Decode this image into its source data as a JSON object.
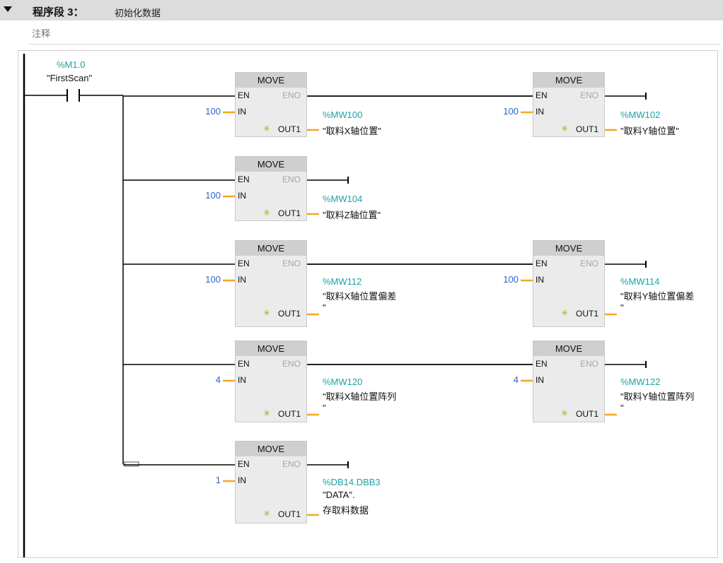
{
  "network": {
    "label": "程序段 3：",
    "title": "初始化数据",
    "comment": "注释"
  },
  "contact": {
    "address": "%M1.0",
    "tag": "\"FirstScan\""
  },
  "pins": {
    "block_title": "MOVE",
    "en": "EN",
    "eno": "ENO",
    "in": "IN",
    "out": "OUT1"
  },
  "colors": {
    "wire": "#000000",
    "output_wire": "#f5a623",
    "address": "#1ca3a6",
    "constant": "#2d64c7",
    "block_fill": "#ebebeb",
    "block_header": "#cfcfcf"
  },
  "blocks": [
    {
      "in_value": "100",
      "out_address": "%MW100",
      "out_lines": [
        "\"取料X轴位置\""
      ]
    },
    {
      "in_value": "100",
      "out_address": "%MW102",
      "out_lines": [
        "\"取料Y轴位置\""
      ]
    },
    {
      "in_value": "100",
      "out_address": "%MW104",
      "out_lines": [
        "\"取料Z轴位置\""
      ]
    },
    {
      "in_value": "100",
      "out_address": "%MW112",
      "out_lines": [
        "\"取料X轴位置偏差",
        "\""
      ]
    },
    {
      "in_value": "100",
      "out_address": "%MW114",
      "out_lines": [
        "\"取料Y轴位置偏差",
        "\""
      ]
    },
    {
      "in_value": "4",
      "out_address": "%MW120",
      "out_lines": [
        "\"取料X轴位置阵列",
        "\""
      ]
    },
    {
      "in_value": "4",
      "out_address": "%MW122",
      "out_lines": [
        "\"取料Y轴位置阵列",
        "\""
      ]
    },
    {
      "in_value": "1",
      "out_address": "%DB14.DBB3",
      "out_lines": [
        "\"DATA\".",
        "存取料数据"
      ]
    }
  ]
}
